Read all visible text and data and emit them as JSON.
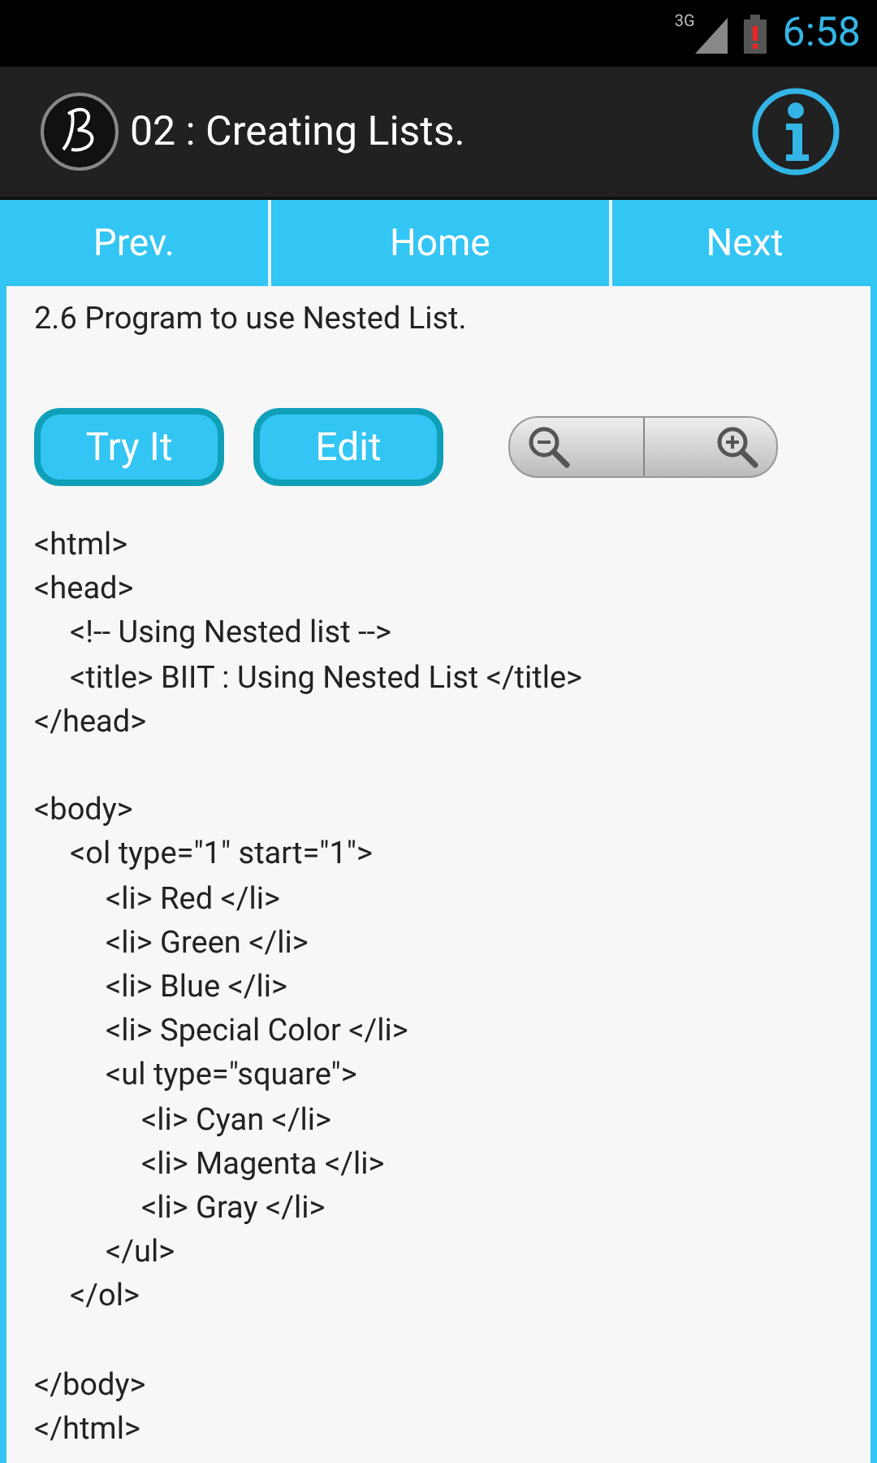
{
  "status_bar": {
    "network": "3G",
    "time": "6:58"
  },
  "app_bar": {
    "title": "02 : Creating Lists."
  },
  "nav": [
    {
      "label": "Prev."
    },
    {
      "label": "Home"
    },
    {
      "label": "Next"
    }
  ],
  "heading": "2.6 Program to use Nested List.",
  "buttons": [
    {
      "label": "Try It"
    },
    {
      "label": "Edit"
    }
  ],
  "code": [
    {
      "kind": "line",
      "text": "<html>"
    },
    {
      "kind": "line",
      "text": "<head>",
      "children": [
        {
          "kind": "line",
          "text": "<!-- Using Nested list -->"
        },
        {
          "kind": "line",
          "text": "<title> BIIT : Using Nested List </title>"
        }
      ]
    },
    {
      "kind": "line",
      "text": "</head>"
    },
    {
      "kind": "blank"
    },
    {
      "kind": "line",
      "text": "<body>",
      "children": [
        {
          "kind": "line",
          "text": "<ol type=\"1\" start=\"1\">",
          "children": [
            {
              "kind": "line",
              "text": "<li> Red </li>"
            },
            {
              "kind": "line",
              "text": "<li> Green </li>"
            },
            {
              "kind": "line",
              "text": "<li> Blue </li>"
            },
            {
              "kind": "line",
              "text": "<li> Special Color </li>"
            },
            {
              "kind": "line",
              "text": "<ul type=\"square\">",
              "children": [
                {
                  "kind": "line",
                  "text": "<li> Cyan </li>"
                },
                {
                  "kind": "line",
                  "text": "<li> Magenta </li>"
                },
                {
                  "kind": "line",
                  "text": "<li> Gray </li>"
                }
              ]
            },
            {
              "kind": "line",
              "text": "</ul>"
            }
          ]
        },
        {
          "kind": "line",
          "text": "</ol>"
        }
      ]
    },
    {
      "kind": "blank"
    },
    {
      "kind": "line",
      "text": "</body>"
    },
    {
      "kind": "line",
      "text": "</html>"
    }
  ]
}
